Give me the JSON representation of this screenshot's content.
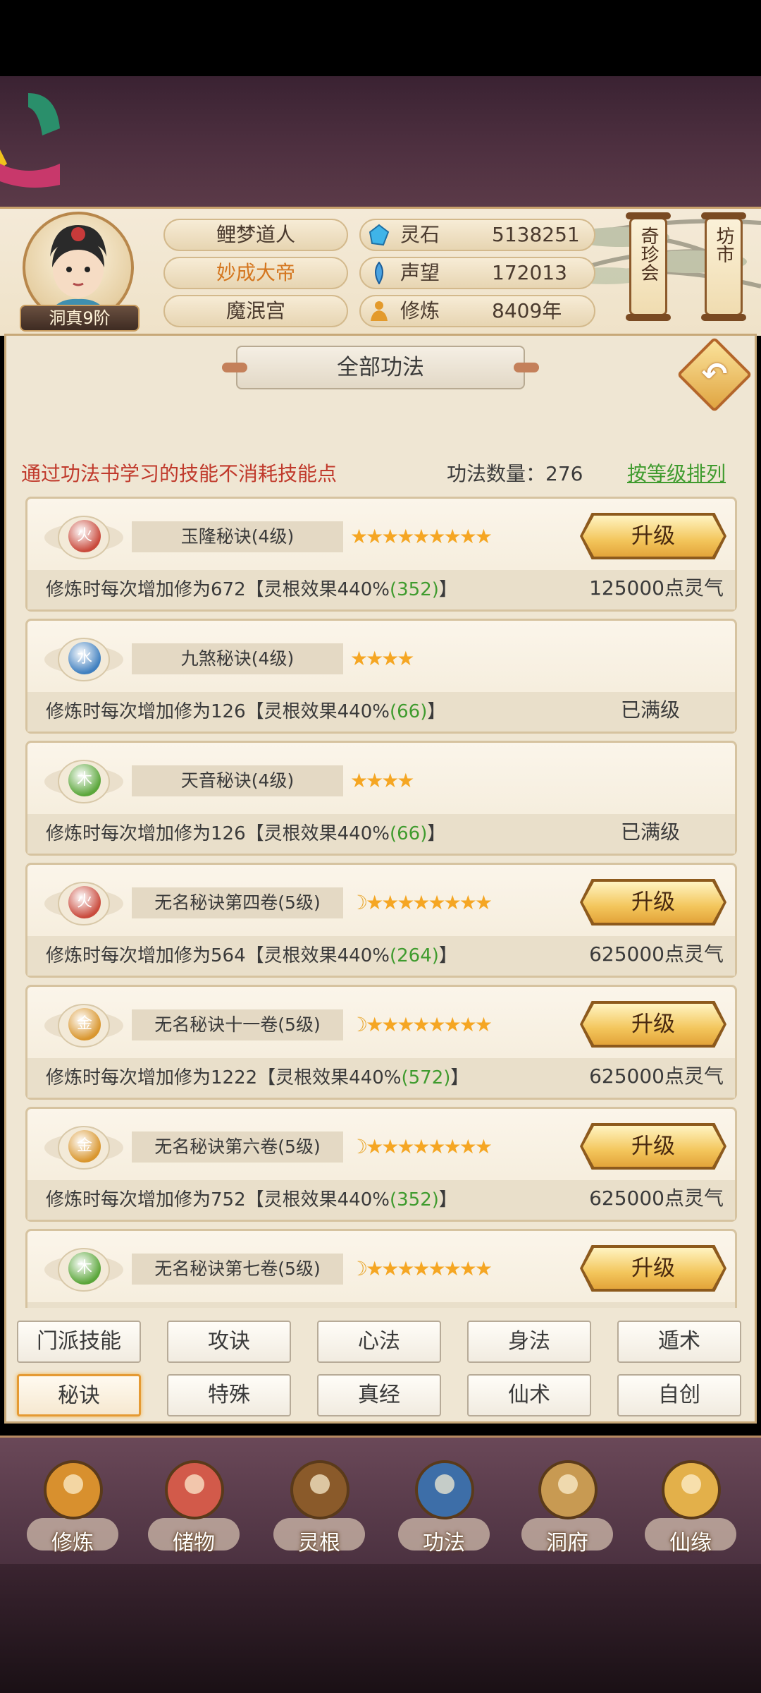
{
  "header": {
    "player_name": "鲤梦道人",
    "title": "妙成大帝",
    "sect": "魔泯宫",
    "rank": "洞真9阶",
    "stats": [
      {
        "icon": "spirit-stone-icon",
        "label": "灵石",
        "value": "5138251"
      },
      {
        "icon": "reputation-icon",
        "label": "声望",
        "value": "172013"
      },
      {
        "icon": "cultivation-icon",
        "label": "修炼",
        "value": "8409年"
      }
    ],
    "shop_buttons": [
      "奇珍会",
      "坊市"
    ]
  },
  "panel": {
    "title": "全部功法",
    "note": "通过功法书学习的技能不消耗技能点",
    "count_label": "功法数量：276",
    "sort_link": "按等级排列"
  },
  "skills": [
    {
      "element": "火",
      "element_color": "#c94a3c",
      "name": "玉隆秘诀(4级)",
      "stars": "★★★★★★★★★",
      "moon": "",
      "desc_prefix": "修炼时每次增加修为672【灵根效果440%",
      "desc_green": "(352)",
      "desc_suffix": "】",
      "upgrade": "升级",
      "cost": "125000点灵气",
      "maxed": ""
    },
    {
      "element": "水",
      "element_color": "#3f7fbf",
      "name": "九煞秘诀(4级)",
      "stars": "★★★★",
      "moon": "",
      "desc_prefix": "修炼时每次增加修为126【灵根效果440%",
      "desc_green": "(66)",
      "desc_suffix": "】",
      "upgrade": "",
      "cost": "",
      "maxed": "已满级"
    },
    {
      "element": "木",
      "element_color": "#5aa63a",
      "name": "天音秘诀(4级)",
      "stars": "★★★★",
      "moon": "",
      "desc_prefix": "修炼时每次增加修为126【灵根效果440%",
      "desc_green": "(66)",
      "desc_suffix": "】",
      "upgrade": "",
      "cost": "",
      "maxed": "已满级"
    },
    {
      "element": "火",
      "element_color": "#c94a3c",
      "name": "无名秘诀第四卷(5级)",
      "stars": "★★★★★★★★",
      "moon": "☽",
      "desc_prefix": "修炼时每次增加修为564【灵根效果440%",
      "desc_green": "(264)",
      "desc_suffix": "】",
      "upgrade": "升级",
      "cost": "625000点灵气",
      "maxed": ""
    },
    {
      "element": "金",
      "element_color": "#d9962e",
      "name": "无名秘诀十一卷(5级)",
      "stars": "★★★★★★★★",
      "moon": "☽",
      "desc_prefix": "修炼时每次增加修为1222【灵根效果440%",
      "desc_green": "(572)",
      "desc_suffix": "】",
      "upgrade": "升级",
      "cost": "625000点灵气",
      "maxed": ""
    },
    {
      "element": "金",
      "element_color": "#d9962e",
      "name": "无名秘诀第六卷(5级)",
      "stars": "★★★★★★★★",
      "moon": "☽",
      "desc_prefix": "修炼时每次增加修为752【灵根效果440%",
      "desc_green": "(352)",
      "desc_suffix": "】",
      "upgrade": "升级",
      "cost": "625000点灵气",
      "maxed": ""
    },
    {
      "element": "木",
      "element_color": "#5aa63a",
      "name": "无名秘诀第七卷(5级)",
      "stars": "★★★★★★★★",
      "moon": "☽",
      "desc_prefix": "",
      "desc_green": "",
      "desc_suffix": "",
      "upgrade": "升级",
      "cost": "",
      "maxed": ""
    }
  ],
  "tabs_row1": [
    "门派技能",
    "攻诀",
    "心法",
    "身法",
    "遁术"
  ],
  "tabs_row2": [
    "秘诀",
    "特殊",
    "真经",
    "仙术",
    "自创"
  ],
  "active_tab": "秘诀",
  "nav": [
    {
      "label": "修炼",
      "icon": "meditating-monk-icon"
    },
    {
      "label": "储物",
      "icon": "storage-bag-icon"
    },
    {
      "label": "灵根",
      "icon": "spirit-root-icon"
    },
    {
      "label": "功法",
      "icon": "skill-book-icon"
    },
    {
      "label": "洞府",
      "icon": "cave-dwelling-icon"
    },
    {
      "label": "仙缘",
      "icon": "gourd-icon"
    }
  ]
}
